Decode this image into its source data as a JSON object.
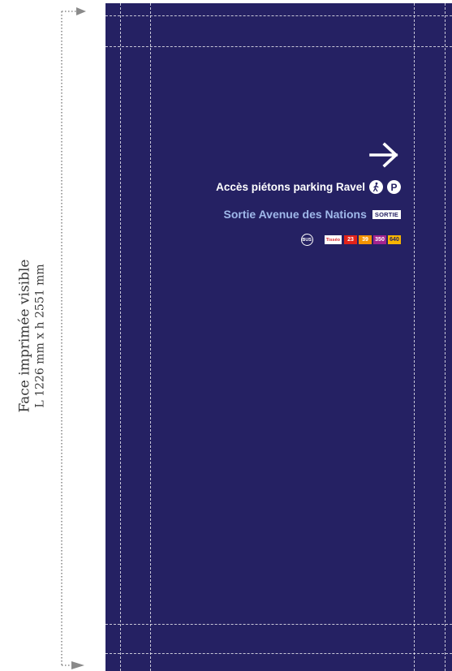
{
  "label": {
    "line1": "Face imprimée visible",
    "line2": "L 1226 mm x h 2551 mm"
  },
  "panel": {
    "background": "#252163",
    "sign": {
      "arrow_icon": "arrow-right-icon",
      "pedestrian_line": "Accès piétons parking Ravel",
      "pedestrian_icon": "pedestrian-icon",
      "parking_icon": "parking-icon",
      "parking_letter": "P",
      "exit_line": "Sortie Avenue des Nations",
      "exit_badge": "SORTIE",
      "bus_icon": "bus-icon",
      "bus_label": "BUS",
      "brand_chip": "Tisséo",
      "lines": [
        {
          "number": "23",
          "color": "#e2231a"
        },
        {
          "number": "39",
          "color": "#f39200"
        },
        {
          "number": "350",
          "color": "#a3238e"
        },
        {
          "number": "640",
          "color": "#f7b500"
        }
      ]
    }
  },
  "colors": {
    "text_light": "#ffffff",
    "text_accent": "#9fb8ea",
    "guides": "#ffffff",
    "dimension_line": "#8a8a8a"
  }
}
